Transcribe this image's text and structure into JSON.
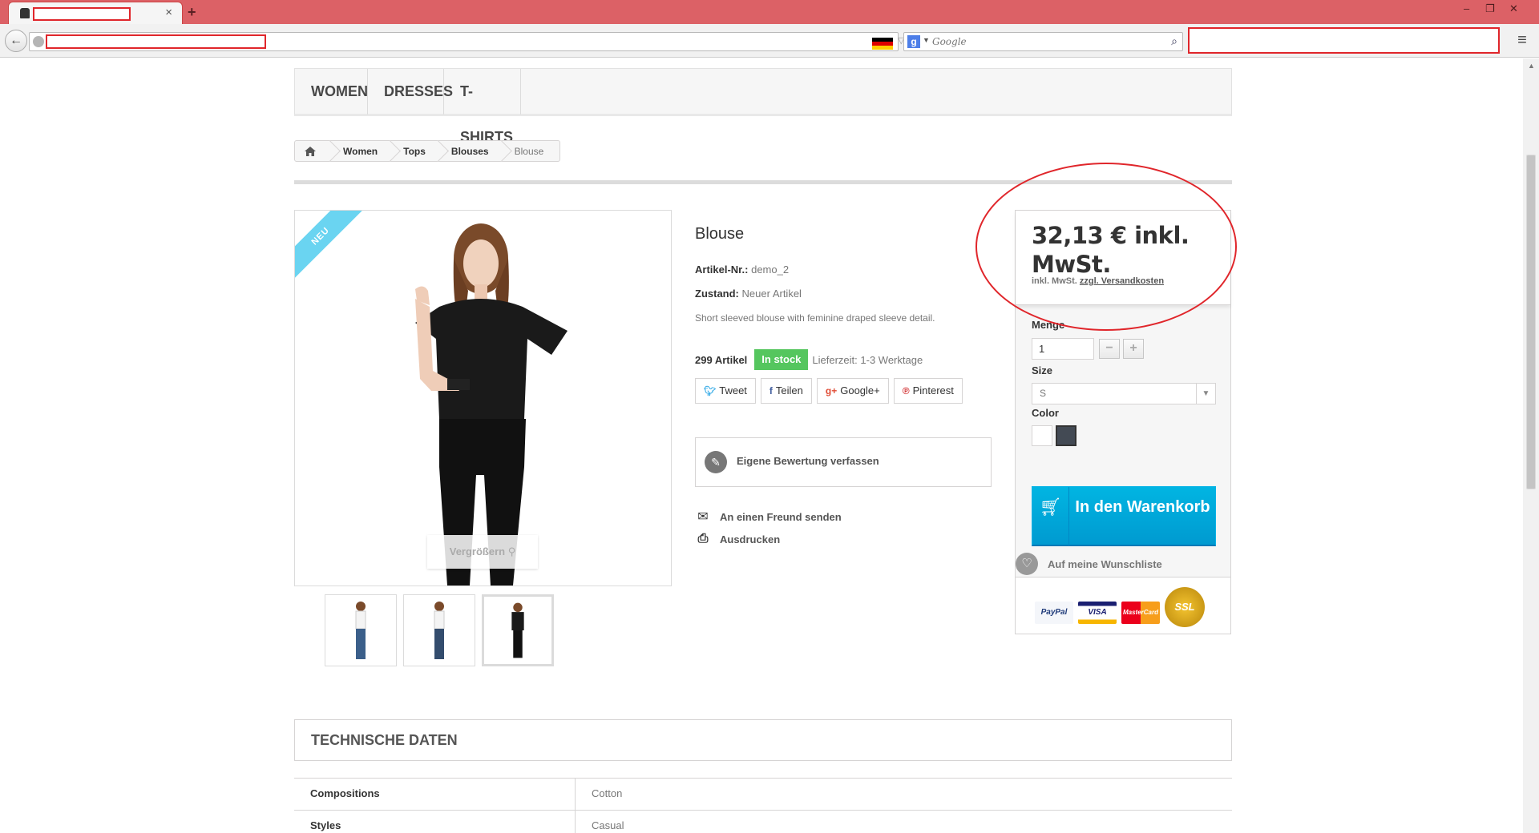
{
  "browser": {
    "tab": {
      "close": "×"
    },
    "new_tab": "+",
    "window": {
      "minimize": "–",
      "restore": "❐",
      "close": "✕"
    },
    "search_placeholder": "Google",
    "search_engine_letter": "g"
  },
  "nav": {
    "items": [
      "WOMEN",
      "DRESSES",
      "T-SHIRTS"
    ]
  },
  "breadcrumb": {
    "items": [
      "Women",
      "Tops",
      "Blouses"
    ],
    "current": "Blouse"
  },
  "product": {
    "badge": "NEU",
    "zoom_label": "Vergrößern",
    "title": "Blouse",
    "ref_label": "Artikel-Nr.:",
    "ref_value": "demo_2",
    "condition_label": "Zustand:",
    "condition_value": "Neuer Artikel",
    "description": "Short sleeved blouse with feminine draped sleeve detail.",
    "quantity_available": "299 Artikel",
    "stock_status": "In stock",
    "delivery": "Lieferzeit: 1-3 Werktage",
    "social": [
      {
        "icon": "twitter-icon",
        "label": "Tweet"
      },
      {
        "icon": "facebook-icon",
        "label": "Teilen"
      },
      {
        "icon": "google-plus-icon",
        "label": "Google+"
      },
      {
        "icon": "pinterest-icon",
        "label": "Pinterest"
      }
    ],
    "review_label": "Eigene Bewertung verfassen",
    "send_friend": "An einen Freund senden",
    "print": "Ausdrucken"
  },
  "buybox": {
    "price": "32,13 € inkl. MwSt.",
    "price_note_prefix": "inkl. MwSt.",
    "price_note_link": "zzgl. Versandkosten",
    "qty_label": "Menge",
    "qty_value": "1",
    "size_label": "Size",
    "size_value": "S",
    "color_label": "Color",
    "colors": [
      "#ffffff",
      "#434a54"
    ],
    "cart_label": "In den Warenkorb",
    "wishlist_label": "Auf meine Wunschliste",
    "payments": [
      "PayPal",
      "VISA",
      "MasterCard",
      "SSL"
    ]
  },
  "tech": {
    "title": "TECHNISCHE DATEN",
    "rows": [
      {
        "key": "Compositions",
        "value": "Cotton"
      },
      {
        "key": "Styles",
        "value": "Casual"
      }
    ]
  }
}
